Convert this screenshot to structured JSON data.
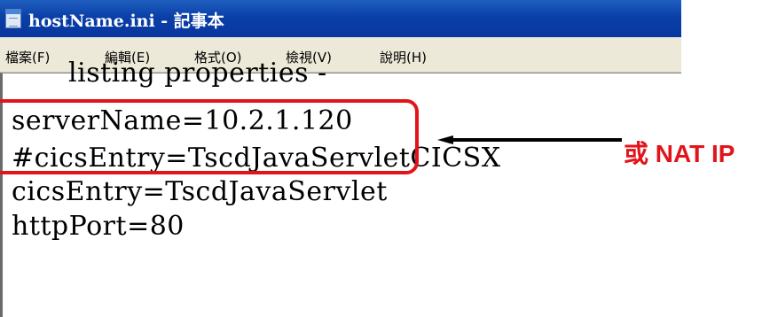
{
  "window": {
    "title": "hostName.ini - 記事本"
  },
  "menu": {
    "items": [
      {
        "label": "檔案(F)"
      },
      {
        "label": "編輯(E)"
      },
      {
        "label": "格式(O)"
      },
      {
        "label": "檢視(V)"
      },
      {
        "label": "說明(H)"
      }
    ]
  },
  "editor": {
    "lines": [
      "listing properties -",
      "serverName=10.2.1.120",
      "#cicsEntry=TscdJavaServletCICSX",
      "cicsEntry=TscdJavaServlet",
      "httpPort=80"
    ]
  },
  "annotation": {
    "text": "或 NAT IP",
    "color": "#e2141a"
  },
  "colors": {
    "titlebar": "#0a3fa8",
    "menubar": "#ece9d8",
    "highlight": "#e2141a"
  }
}
